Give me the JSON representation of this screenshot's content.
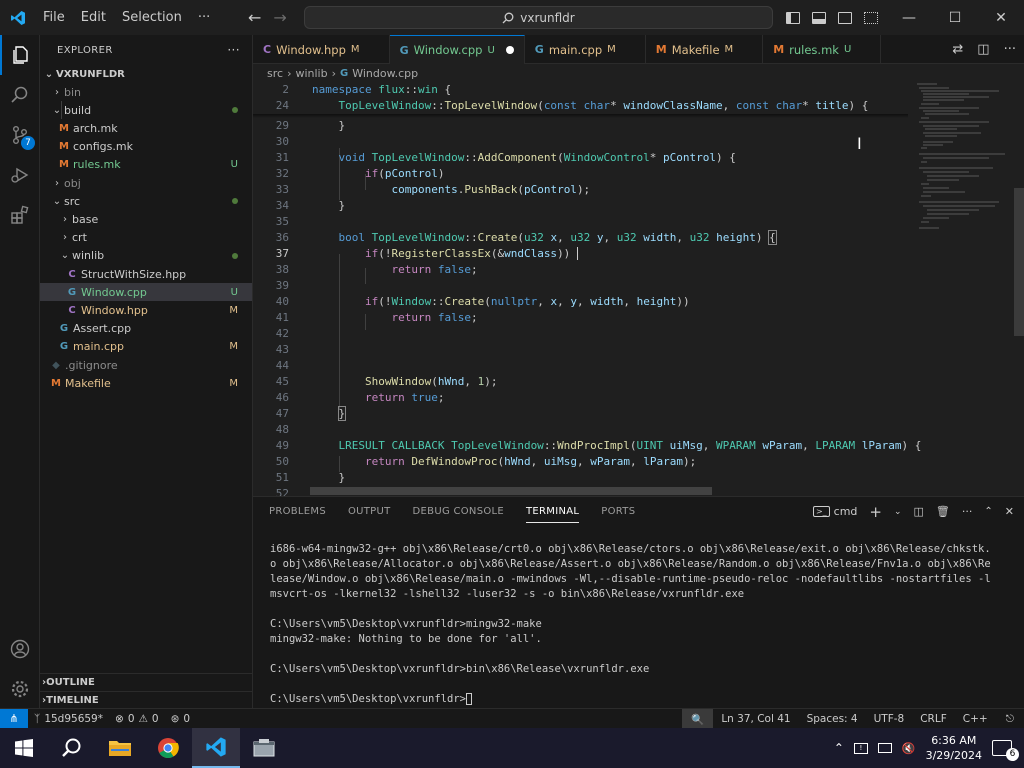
{
  "menu": {
    "file": "File",
    "edit": "Edit",
    "selection": "Selection",
    "more": "···"
  },
  "search": {
    "text": "vxrunfldr"
  },
  "activity": {
    "scm_badge": "7"
  },
  "explorer": {
    "title": "EXPLORER",
    "more": "···",
    "root": "VXRUNFLDR",
    "items": [
      {
        "label": "bin",
        "type": "folder",
        "status": ""
      },
      {
        "label": "build",
        "type": "folder-open",
        "status": "dot"
      },
      {
        "label": "arch.mk",
        "type": "mk",
        "status": ""
      },
      {
        "label": "configs.mk",
        "type": "mk",
        "status": ""
      },
      {
        "label": "rules.mk",
        "type": "mk",
        "status": "U"
      },
      {
        "label": "obj",
        "type": "folder",
        "status": ""
      },
      {
        "label": "src",
        "type": "folder-open",
        "status": "dot"
      },
      {
        "label": "base",
        "type": "folder",
        "status": ""
      },
      {
        "label": "crt",
        "type": "folder",
        "status": ""
      },
      {
        "label": "winlib",
        "type": "folder-open",
        "status": "dot"
      },
      {
        "label": "StructWithSize.hpp",
        "type": "hpp",
        "status": ""
      },
      {
        "label": "Window.cpp",
        "type": "cpp",
        "status": "U"
      },
      {
        "label": "Window.hpp",
        "type": "hpp",
        "status": "M"
      },
      {
        "label": "Assert.cpp",
        "type": "cpp",
        "status": ""
      },
      {
        "label": "main.cpp",
        "type": "cpp",
        "status": "M"
      },
      {
        "label": ".gitignore",
        "type": "git",
        "status": ""
      },
      {
        "label": "Makefile",
        "type": "make",
        "status": "M"
      }
    ],
    "outline": "OUTLINE",
    "timeline": "TIMELINE"
  },
  "tabs": [
    {
      "label": "Window.hpp",
      "status": "M",
      "icon": "C"
    },
    {
      "label": "Window.cpp",
      "status": "U",
      "icon": "G"
    },
    {
      "label": "main.cpp",
      "status": "M",
      "icon": "G"
    },
    {
      "label": "Makefile",
      "status": "M",
      "icon": "M"
    },
    {
      "label": "rules.mk",
      "status": "U",
      "icon": "M"
    }
  ],
  "breadcrumb": {
    "a": "src",
    "b": "winlib",
    "c": "Window.cpp"
  },
  "editor": {
    "line_numbers": [
      "2",
      "24",
      "29",
      "30",
      "31",
      "32",
      "33",
      "34",
      "35",
      "36",
      "37",
      "38",
      "39",
      "40",
      "41",
      "42",
      "43",
      "44",
      "45",
      "46",
      "47",
      "48",
      "49",
      "50",
      "51",
      "52"
    ]
  },
  "panel": {
    "tabs": [
      "PROBLEMS",
      "OUTPUT",
      "DEBUG CONSOLE",
      "TERMINAL",
      "PORTS"
    ],
    "terminal_name": "cmd",
    "lines": [
      "i686-w64-mingw32-g++ obj\\x86\\Release/crt0.o obj\\x86\\Release/ctors.o obj\\x86\\Release/exit.o obj\\x86\\Release/chkstk.",
      "o obj\\x86\\Release/Allocator.o obj\\x86\\Release/Assert.o obj\\x86\\Release/Random.o obj\\x86\\Release/Fnv1a.o obj\\x86\\Re",
      "lease/Window.o obj\\x86\\Release/main.o -mwindows -Wl,--disable-runtime-pseudo-reloc -nodefaultlibs -nostartfiles -l",
      "msvcrt-os -lkernel32 -lshell32 -luser32 -s -o bin\\x86\\Release/vxrunfldr.exe",
      "",
      "C:\\Users\\vm5\\Desktop\\vxrunfldr>mingw32-make",
      "mingw32-make: Nothing to be done for 'all'.",
      "",
      "C:\\Users\\vm5\\Desktop\\vxrunfldr>bin\\x86\\Release\\vxrunfldr.exe",
      "",
      "C:\\Users\\vm5\\Desktop\\vxrunfldr>"
    ]
  },
  "status": {
    "branch": "15d95659*",
    "errors": "0",
    "warnings": "0",
    "ports": "0",
    "position": "Ln 37, Col 41",
    "spaces": "Spaces: 4",
    "encoding": "UTF-8",
    "eol": "CRLF",
    "language": "C++"
  },
  "taskbar": {
    "time": "6:36 AM",
    "date": "3/29/2024",
    "notifications": "6"
  },
  "colors": {
    "accent": "#0078d4",
    "untracked": "#73c991",
    "modified": "#e2c08d"
  }
}
